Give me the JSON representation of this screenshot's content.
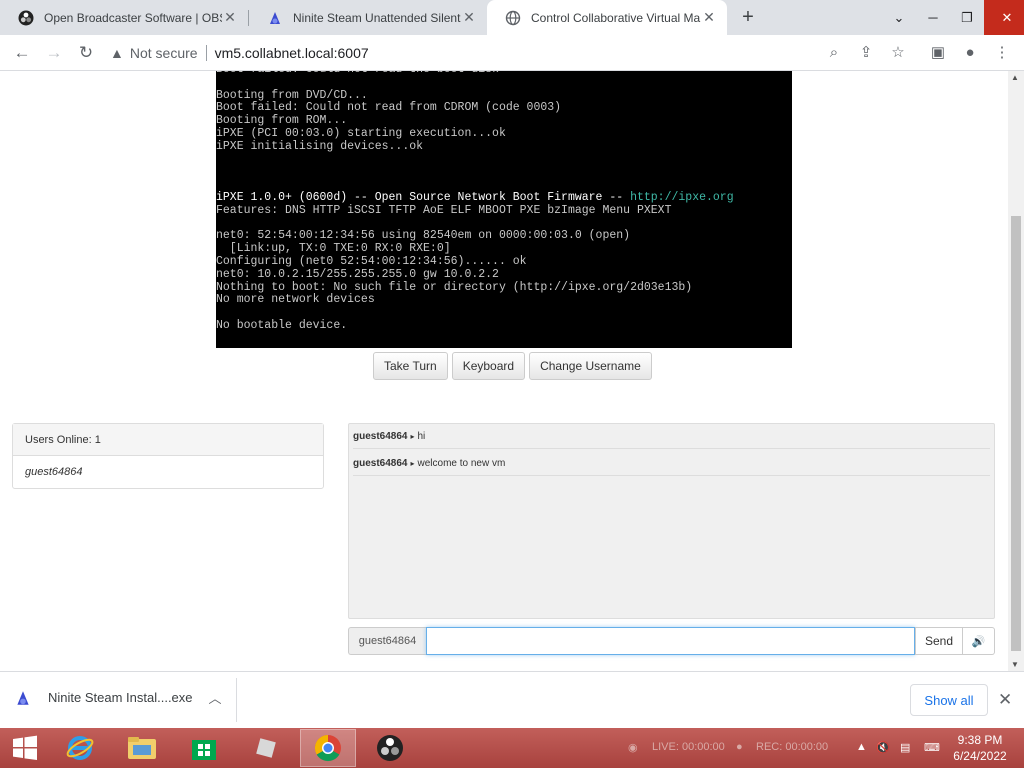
{
  "browser": {
    "tabs": [
      {
        "title": "Open Broadcaster Software | OBS",
        "active": false
      },
      {
        "title": "Ninite Steam Unattended Silent I",
        "active": false
      },
      {
        "title": "Control Collaborative Virtual Ma",
        "active": true
      }
    ],
    "security_label": "Not secure",
    "url": "vm5.collabnet.local:6007"
  },
  "vm": {
    "console_lines": [
      {
        "text": "Boot failed: could not read the boot disk",
        "style": ""
      },
      {
        "text": "",
        "style": ""
      },
      {
        "text": "Booting from DVD/CD...",
        "style": ""
      },
      {
        "text": "Boot failed: Could not read from CDROM (code 0003)",
        "style": ""
      },
      {
        "text": "Booting from ROM...",
        "style": ""
      },
      {
        "text": "iPXE (PCI 00:03.0) starting execution...ok",
        "style": ""
      },
      {
        "text": "iPXE initialising devices...ok",
        "style": ""
      },
      {
        "text": "",
        "style": ""
      },
      {
        "text": "",
        "style": ""
      },
      {
        "text": "",
        "style": ""
      },
      {
        "text": "iPXE 1.0.0+ (0600d) -- Open Source Network Boot Firmware -- http://ipxe.org",
        "style": "ipxe"
      },
      {
        "text": "Features: DNS HTTP iSCSI TFTP AoE ELF MBOOT PXE bzImage Menu PXEXT",
        "style": ""
      },
      {
        "text": "",
        "style": ""
      },
      {
        "text": "net0: 52:54:00:12:34:56 using 82540em on 0000:00:03.0 (open)",
        "style": ""
      },
      {
        "text": "  [Link:up, TX:0 TXE:0 RX:0 RXE:0]",
        "style": ""
      },
      {
        "text": "Configuring (net0 52:54:00:12:34:56)...... ok",
        "style": ""
      },
      {
        "text": "net0: 10.0.2.15/255.255.255.0 gw 10.0.2.2",
        "style": ""
      },
      {
        "text": "Nothing to boot: No such file or directory (http://ipxe.org/2d03e13b)",
        "style": ""
      },
      {
        "text": "No more network devices",
        "style": ""
      },
      {
        "text": "",
        "style": ""
      },
      {
        "text": "No bootable device.",
        "style": ""
      }
    ],
    "buttons": {
      "take_turn": "Take Turn",
      "keyboard": "Keyboard",
      "change_username": "Change Username"
    }
  },
  "users": {
    "header": "Users Online: 1",
    "list": [
      "guest64864"
    ]
  },
  "chat": {
    "messages": [
      {
        "user": "guest64864",
        "text": "hi"
      },
      {
        "user": "guest64864",
        "text": "welcome to new vm"
      }
    ],
    "username": "guest64864",
    "input_value": "",
    "send_label": "Send",
    "sound_icon": "speaker-icon"
  },
  "downloads": {
    "file": "Ninite Steam Instal....exe",
    "show_all": "Show all"
  },
  "taskbar": {
    "live": "LIVE: 00:00:00",
    "rec": "REC: 00:00:00",
    "time": "9:38 PM",
    "date": "6/24/2022"
  },
  "colors": {
    "taskbar": "#b04a46",
    "console_url": "#3fb8a6",
    "link": "#1a73e8"
  }
}
